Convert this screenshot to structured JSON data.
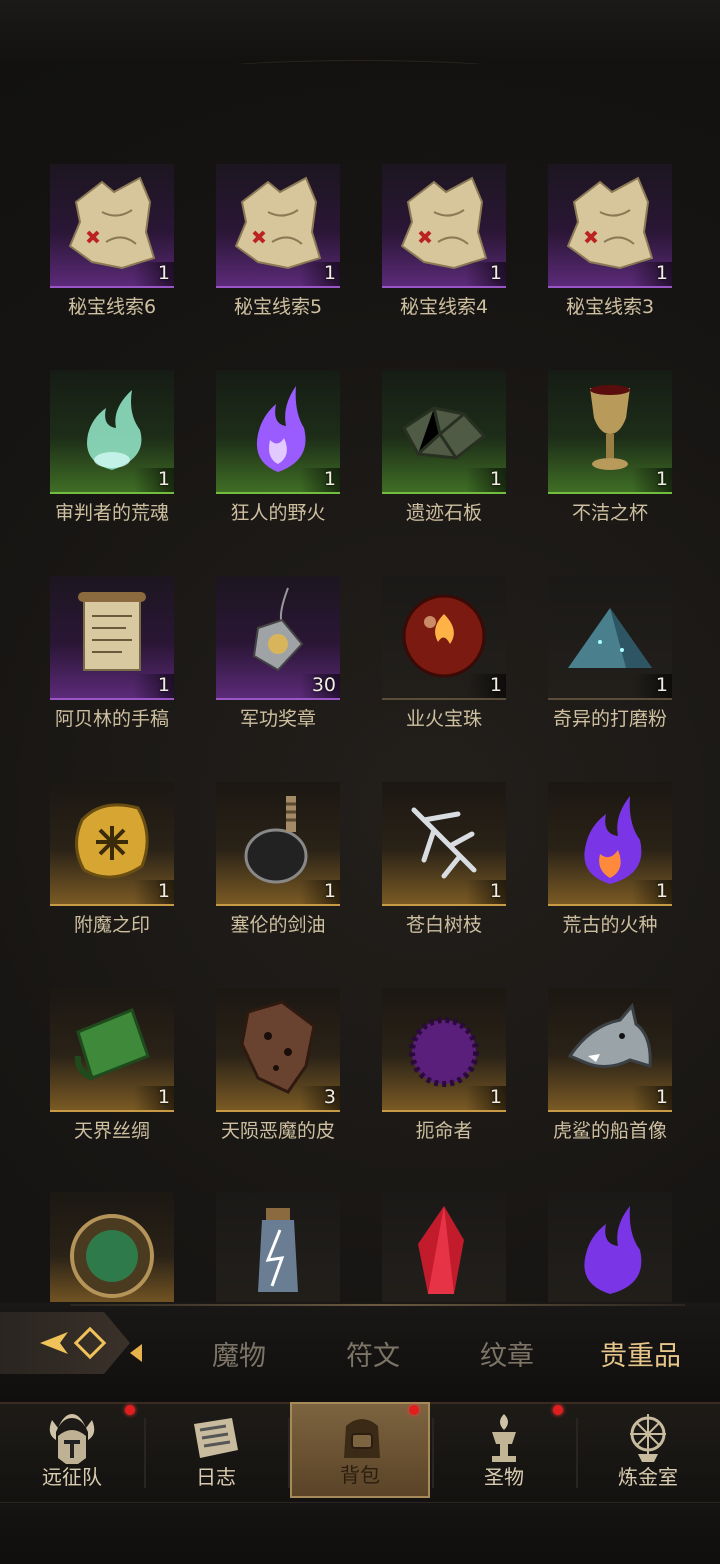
{
  "items": [
    {
      "name": "秘宝线索6",
      "qty": "1",
      "rarity": "purple",
      "icon": "treasure-map-icon"
    },
    {
      "name": "秘宝线索5",
      "qty": "1",
      "rarity": "purple",
      "icon": "treasure-map-icon"
    },
    {
      "name": "秘宝线索4",
      "qty": "1",
      "rarity": "purple",
      "icon": "treasure-map-icon"
    },
    {
      "name": "秘宝线索3",
      "qty": "1",
      "rarity": "purple",
      "icon": "treasure-map-icon"
    },
    {
      "name": "审判者的荒魂",
      "qty": "1",
      "rarity": "green",
      "icon": "spirit-flame-icon"
    },
    {
      "name": "狂人的野火",
      "qty": "1",
      "rarity": "green",
      "icon": "purple-flame-icon"
    },
    {
      "name": "遗迹石板",
      "qty": "1",
      "rarity": "green",
      "icon": "stone-slab-icon"
    },
    {
      "name": "不洁之杯",
      "qty": "1",
      "rarity": "green",
      "icon": "goblet-icon"
    },
    {
      "name": "阿贝林的手稿",
      "qty": "1",
      "rarity": "purple",
      "icon": "scroll-icon"
    },
    {
      "name": "军功奖章",
      "qty": "30",
      "rarity": "purple",
      "icon": "medal-icon"
    },
    {
      "name": "业火宝珠",
      "qty": "1",
      "rarity": "plain",
      "icon": "fire-orb-icon"
    },
    {
      "name": "奇异的打磨粉",
      "qty": "1",
      "rarity": "plain",
      "icon": "powder-pile-icon"
    },
    {
      "name": "附魔之印",
      "qty": "1",
      "rarity": "orange",
      "icon": "enchant-seal-icon"
    },
    {
      "name": "塞伦的剑油",
      "qty": "1",
      "rarity": "orange",
      "icon": "oil-flask-icon"
    },
    {
      "name": "苍白树枝",
      "qty": "1",
      "rarity": "orange",
      "icon": "pale-branch-icon"
    },
    {
      "name": "荒古的火种",
      "qty": "1",
      "rarity": "orange",
      "icon": "ancient-flame-icon"
    },
    {
      "name": "天界丝绸",
      "qty": "1",
      "rarity": "orange",
      "icon": "silk-roll-icon"
    },
    {
      "name": "天陨恶魔的皮",
      "qty": "3",
      "rarity": "orange",
      "icon": "demon-hide-icon"
    },
    {
      "name": "扼命者",
      "qty": "1",
      "rarity": "orange",
      "icon": "dark-orb-icon"
    },
    {
      "name": "虎鲨的船首像",
      "qty": "1",
      "rarity": "orange",
      "icon": "shark-figurehead-icon"
    },
    {
      "name": "",
      "qty": "",
      "rarity": "orange",
      "icon": "jade-amulet-icon"
    },
    {
      "name": "",
      "qty": "",
      "rarity": "plain",
      "icon": "lightning-bottle-icon"
    },
    {
      "name": "",
      "qty": "",
      "rarity": "plain",
      "icon": "red-crystal-icon"
    },
    {
      "name": "",
      "qty": "",
      "rarity": "plain",
      "icon": "violet-flame-icon"
    }
  ],
  "category_tabs": [
    {
      "label": "魔物",
      "active": false
    },
    {
      "label": "符文",
      "active": false
    },
    {
      "label": "纹章",
      "active": false
    },
    {
      "label": "贵重品",
      "active": true
    }
  ],
  "nav": [
    {
      "label": "远征队",
      "icon": "helmet-icon",
      "badge": true,
      "active": false
    },
    {
      "label": "日志",
      "icon": "journal-icon",
      "badge": false,
      "active": false
    },
    {
      "label": "背包",
      "icon": "backpack-icon",
      "badge": true,
      "active": true
    },
    {
      "label": "圣物",
      "icon": "relic-icon",
      "badge": true,
      "active": false
    },
    {
      "label": "炼金室",
      "icon": "alchemy-icon",
      "badge": false,
      "active": false
    }
  ],
  "colors": {
    "accent": "#e5b24b",
    "badge": "#e01e1e",
    "purple": "#9a56c6",
    "green": "#72bd3e",
    "orange": "#c99a45"
  }
}
